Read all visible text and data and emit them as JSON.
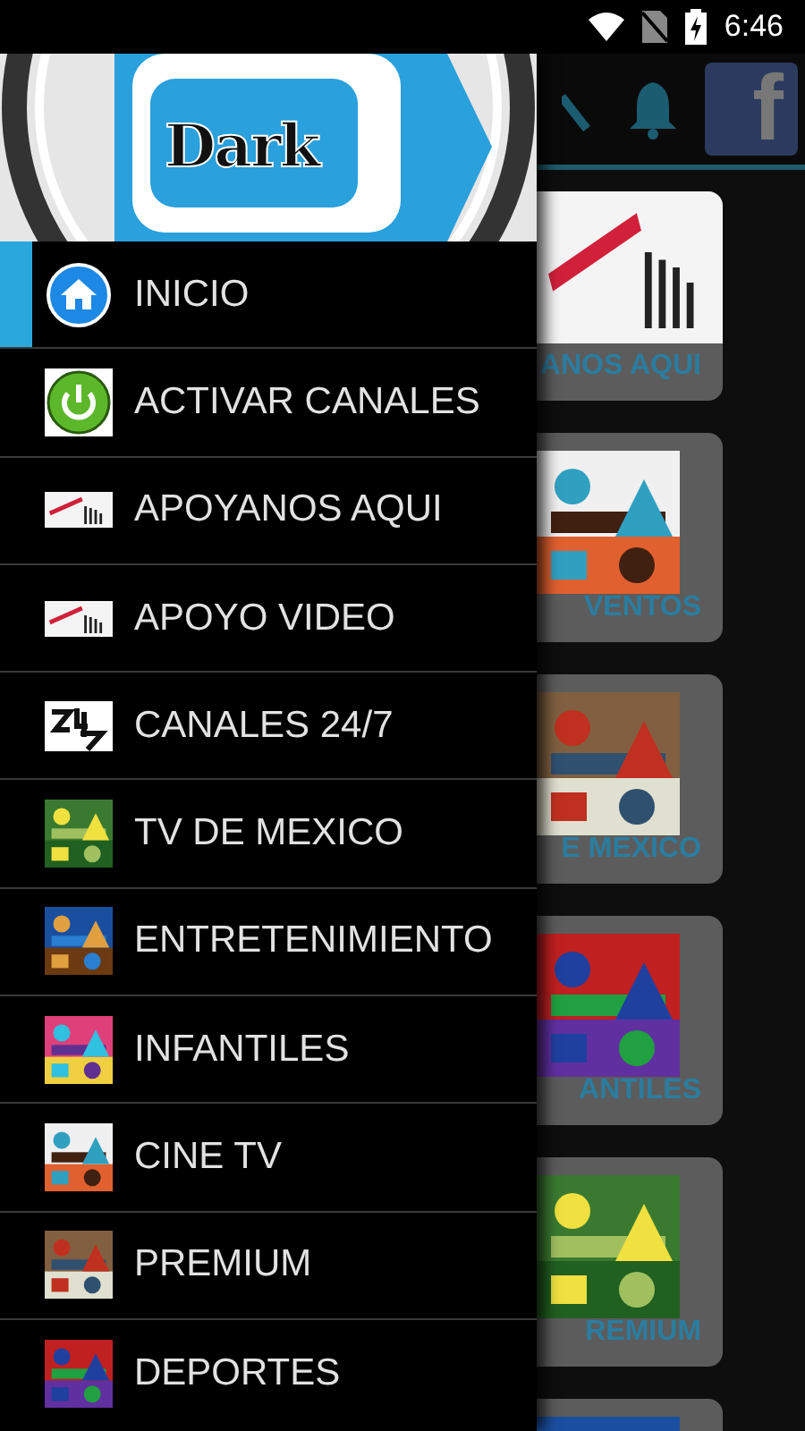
{
  "status_bar": {
    "time": "6:46"
  },
  "toolbar": {
    "facebook_letter": "f"
  },
  "cards": [
    {
      "label": "ANOS AQUI",
      "kind": "ad"
    },
    {
      "label": "VENTOS",
      "kind": "picture"
    },
    {
      "label": "E MEXICO",
      "kind": "picture"
    },
    {
      "label": "ANTILES",
      "kind": "picture"
    },
    {
      "label": "REMIUM",
      "kind": "picture"
    },
    {
      "kind": "picture"
    }
  ],
  "drawer": {
    "logo": "Dark",
    "items": [
      {
        "label": "INICIO",
        "kind": "home",
        "selected": true
      },
      {
        "label": "ACTIVAR CANALES",
        "kind": "power",
        "selected": false
      },
      {
        "label": "APOYANOS AQUI",
        "kind": "ad",
        "selected": false
      },
      {
        "label": "APOYO VIDEO",
        "kind": "ad",
        "selected": false
      },
      {
        "label": "CANALES 24/7",
        "kind": "logo",
        "selected": false
      },
      {
        "label": "TV DE MEXICO",
        "kind": "picture",
        "selected": false
      },
      {
        "label": "ENTRETENIMIENTO",
        "kind": "picture",
        "selected": false
      },
      {
        "label": "INFANTILES",
        "kind": "picture",
        "selected": false
      },
      {
        "label": "CINE TV",
        "kind": "picture",
        "selected": false
      },
      {
        "label": "PREMIUM",
        "kind": "picture",
        "selected": false
      },
      {
        "label": "DEPORTES",
        "kind": "picture",
        "selected": false
      }
    ]
  }
}
